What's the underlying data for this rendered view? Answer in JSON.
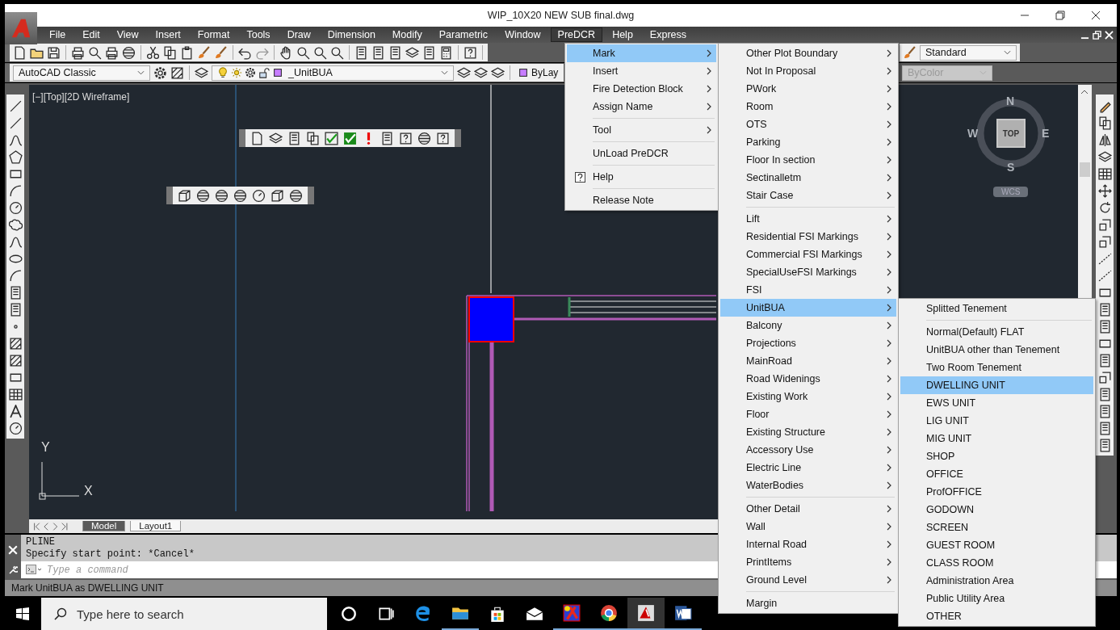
{
  "window": {
    "title": "WIP_10X20 NEW SUB final.dwg"
  },
  "menubar": [
    {
      "label": "File",
      "selected": false
    },
    {
      "label": "Edit",
      "selected": false
    },
    {
      "label": "View",
      "selected": false
    },
    {
      "label": "Insert",
      "selected": false
    },
    {
      "label": "Format",
      "selected": false
    },
    {
      "label": "Tools",
      "selected": false
    },
    {
      "label": "Draw",
      "selected": false
    },
    {
      "label": "Dimension",
      "selected": false
    },
    {
      "label": "Modify",
      "selected": false
    },
    {
      "label": "Parametric",
      "selected": false
    },
    {
      "label": "Window",
      "selected": false
    },
    {
      "label": "PreDCR",
      "selected": true
    },
    {
      "label": "Help",
      "selected": false
    },
    {
      "label": "Express",
      "selected": false
    }
  ],
  "toolbar": {
    "workspace": "AutoCAD Classic",
    "layer": "_UnitBUA",
    "color_control": "ByLay",
    "text_style": "Standard",
    "plot_style": {
      "value": "ByColor",
      "disabled": true
    }
  },
  "viewport": {
    "label": "[−][Top][2D Wireframe]",
    "viewcube": {
      "north": "N",
      "south": "S",
      "east": "E",
      "west": "W",
      "face": "TOP",
      "ucs": "WCS"
    },
    "ucs_axes": {
      "x": "X",
      "y": "Y"
    }
  },
  "layout_tabs": [
    {
      "label": "Model",
      "selected": true
    },
    {
      "label": "Layout1",
      "selected": false
    }
  ],
  "command_line": {
    "history": [
      "PLINE",
      "Specify start point: *Cancel*"
    ],
    "placeholder": "Type a command"
  },
  "status_bar": "Mark UnitBUA as DWELLING UNIT",
  "taskbar": {
    "search_placeholder": "Type here to search"
  },
  "menus": [
    {
      "groups": [
        [
          {
            "label": "Mark",
            "kind": "submenu",
            "selected": true
          },
          {
            "label": "Insert",
            "kind": "submenu",
            "selected": false
          },
          {
            "label": "Fire Detection Block",
            "kind": "submenu",
            "selected": false
          },
          {
            "label": "Assign Name",
            "kind": "submenu",
            "selected": false
          }
        ],
        [
          {
            "label": "Tool",
            "kind": "submenu",
            "selected": false
          }
        ],
        [
          {
            "label": "UnLoad PreDCR",
            "kind": "command",
            "selected": false
          }
        ],
        [
          {
            "label": "Help",
            "kind": "help",
            "selected": false
          }
        ],
        [
          {
            "label": "Release Note",
            "kind": "command",
            "selected": false
          }
        ]
      ]
    },
    {
      "groups": [
        [
          {
            "label": "Other Plot Boundary",
            "kind": "submenu",
            "selected": false
          },
          {
            "label": "Not In Proposal",
            "kind": "submenu",
            "selected": false
          },
          {
            "label": "PWork",
            "kind": "submenu",
            "selected": false
          },
          {
            "label": "Room",
            "kind": "submenu",
            "selected": false
          },
          {
            "label": "OTS",
            "kind": "submenu",
            "selected": false
          },
          {
            "label": "Parking",
            "kind": "submenu",
            "selected": false
          },
          {
            "label": "Floor In section",
            "kind": "submenu",
            "selected": false
          },
          {
            "label": "Sectinalletm",
            "kind": "submenu",
            "selected": false
          },
          {
            "label": "Stair Case",
            "kind": "submenu",
            "selected": false
          }
        ],
        [
          {
            "label": "Lift",
            "kind": "submenu",
            "selected": false
          },
          {
            "label": "Residential FSI Markings",
            "kind": "submenu",
            "selected": false
          },
          {
            "label": "Commercial FSI Markings",
            "kind": "submenu",
            "selected": false
          },
          {
            "label": "SpecialUseFSI Markings",
            "kind": "submenu",
            "selected": false
          },
          {
            "label": "FSI",
            "kind": "submenu",
            "selected": false
          },
          {
            "label": "UnitBUA",
            "kind": "submenu",
            "selected": true
          },
          {
            "label": "Balcony",
            "kind": "submenu",
            "selected": false
          },
          {
            "label": "Projections",
            "kind": "submenu",
            "selected": false
          },
          {
            "label": "MainRoad",
            "kind": "submenu",
            "selected": false
          },
          {
            "label": "Road Widenings",
            "kind": "submenu",
            "selected": false
          },
          {
            "label": "Existing Work",
            "kind": "submenu",
            "selected": false
          },
          {
            "label": "Floor",
            "kind": "submenu",
            "selected": false
          },
          {
            "label": "Existing Structure",
            "kind": "submenu",
            "selected": false
          },
          {
            "label": "Accessory Use",
            "kind": "submenu",
            "selected": false
          },
          {
            "label": "Electric Line",
            "kind": "submenu",
            "selected": false
          },
          {
            "label": "WaterBodies",
            "kind": "submenu",
            "selected": false
          }
        ],
        [
          {
            "label": "Other Detail",
            "kind": "submenu",
            "selected": false
          },
          {
            "label": "Wall",
            "kind": "submenu",
            "selected": false
          },
          {
            "label": "Internal Road",
            "kind": "submenu",
            "selected": false
          },
          {
            "label": "PrintItems",
            "kind": "submenu",
            "selected": false
          },
          {
            "label": "Ground Level",
            "kind": "submenu",
            "selected": false
          }
        ],
        [
          {
            "label": "Margin",
            "kind": "command",
            "selected": false
          }
        ]
      ]
    },
    {
      "groups": [
        [
          {
            "label": "Splitted Tenement",
            "kind": "command",
            "selected": false
          }
        ],
        [
          {
            "label": "Normal(Default) FLAT",
            "kind": "command",
            "selected": false
          },
          {
            "label": "UnitBUA other than Tenement",
            "kind": "command",
            "selected": false
          },
          {
            "label": "Two Room Tenement",
            "kind": "command",
            "selected": false
          },
          {
            "label": "DWELLING UNIT",
            "kind": "command",
            "selected": true
          },
          {
            "label": "EWS UNIT",
            "kind": "command",
            "selected": false
          },
          {
            "label": "LIG UNIT",
            "kind": "command",
            "selected": false
          },
          {
            "label": "MIG UNIT",
            "kind": "command",
            "selected": false
          },
          {
            "label": "SHOP",
            "kind": "command",
            "selected": false
          },
          {
            "label": "OFFICE",
            "kind": "command",
            "selected": false
          },
          {
            "label": "ProfOFFICE",
            "kind": "command",
            "selected": false
          },
          {
            "label": "GODOWN",
            "kind": "command",
            "selected": false
          },
          {
            "label": "SCREEN",
            "kind": "command",
            "selected": false
          },
          {
            "label": "GUEST ROOM",
            "kind": "command",
            "selected": false
          },
          {
            "label": "CLASS ROOM",
            "kind": "command",
            "selected": false
          },
          {
            "label": "Administration Area",
            "kind": "command",
            "selected": false
          },
          {
            "label": "Public Utility Area",
            "kind": "command",
            "selected": false
          },
          {
            "label": "OTHER",
            "kind": "command",
            "selected": false
          }
        ]
      ]
    }
  ]
}
